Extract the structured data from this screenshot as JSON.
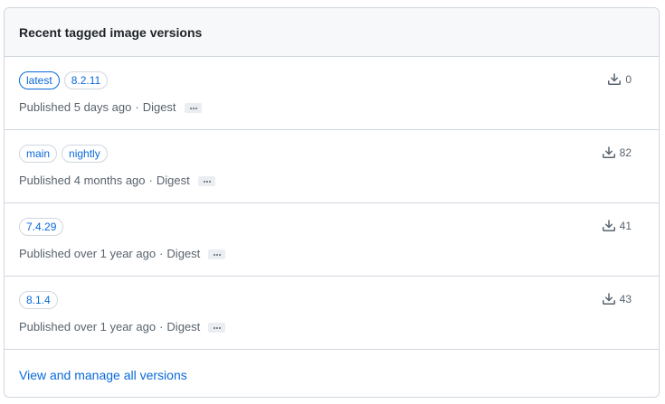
{
  "header": {
    "title": "Recent tagged image versions"
  },
  "versions": [
    {
      "tags": [
        "latest",
        "8.2.11"
      ],
      "published_label": "Published",
      "published_time": "5 days ago",
      "digest_label": "Digest",
      "downloads": "0"
    },
    {
      "tags": [
        "main",
        "nightly"
      ],
      "published_label": "Published",
      "published_time": "4 months ago",
      "digest_label": "Digest",
      "downloads": "82"
    },
    {
      "tags": [
        "7.4.29"
      ],
      "published_label": "Published",
      "published_time": "over 1 year ago",
      "digest_label": "Digest",
      "downloads": "41"
    },
    {
      "tags": [
        "8.1.4"
      ],
      "published_label": "Published",
      "published_time": "over 1 year ago",
      "digest_label": "Digest",
      "downloads": "43"
    }
  ],
  "footer": {
    "link_label": "View and manage all versions"
  },
  "icons": {
    "download": "download-icon",
    "more": "kebab-horizontal-icon"
  },
  "colors": {
    "link": "#0969da",
    "border": "#d0d7de",
    "header_bg": "#f6f8fa",
    "muted_text": "#59636e"
  }
}
